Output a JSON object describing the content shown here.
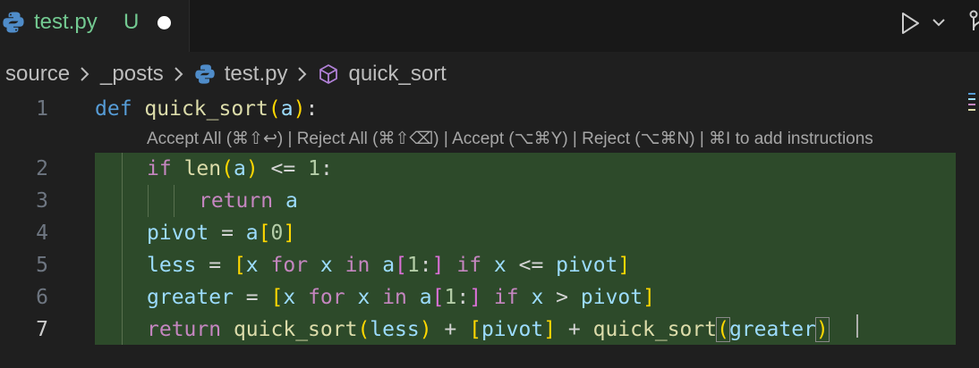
{
  "tab": {
    "filename": "test.py",
    "status": "U",
    "dirty": true
  },
  "breadcrumb": {
    "items": [
      "source",
      "_posts",
      "test.py",
      "quick_sort"
    ]
  },
  "editor": {
    "codelens": "Accept All (⌘⇧↩) | Reject All (⌘⇧⌫) | Accept (⌥⌘Y) | Reject (⌥⌘N) | ⌘I to add instructions",
    "line_numbers": [
      "1",
      "2",
      "3",
      "4",
      "5",
      "6",
      "7"
    ],
    "active_line": 7,
    "lines": [
      "def quick_sort(a):",
      "    if len(a) <= 1:",
      "        return a",
      "    pivot = a[0]",
      "    less = [x for x in a[1:] if x <= pivot]",
      "    greater = [x for x in a[1:] if x > pivot]",
      "    return quick_sort(less) + [pivot] + quick_sort(greater)"
    ]
  },
  "colors": {
    "added_background": "#2d4a2a",
    "tab_untracked": "#73c991",
    "keyword": "#569cd6",
    "control": "#c586c0",
    "function": "#dcdcaa",
    "variable": "#9cdcfe",
    "number": "#b5cea8"
  },
  "icons": {
    "tab": "python-icon",
    "run": "play-icon",
    "run_menu": "chevron-down-icon",
    "scm": "git-branch-icon",
    "symbol": "method-cube-icon"
  }
}
